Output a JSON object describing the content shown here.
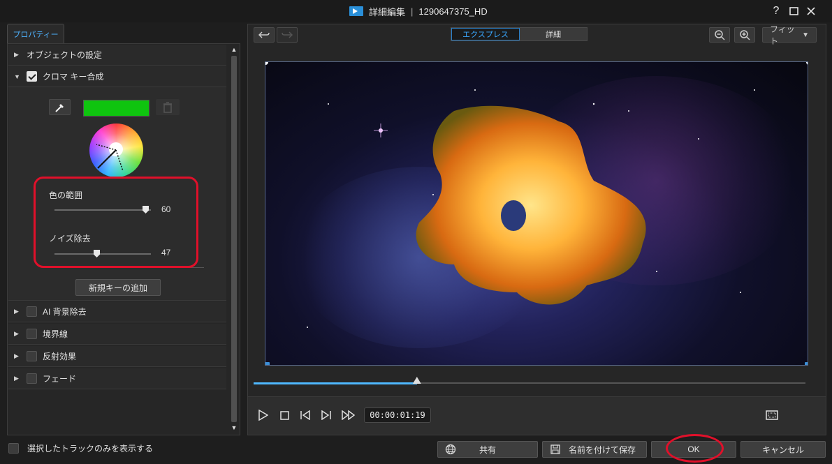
{
  "window": {
    "title": "詳細編集",
    "separator": "|",
    "file_name": "1290647375_HD",
    "help_icon": "help-icon",
    "maximize_icon": "maximize-icon",
    "close_icon": "close-icon"
  },
  "left_panel": {
    "tab_label": "プロパティー",
    "sections": [
      {
        "label": "オブジェクトの設定",
        "expanded": false,
        "has_checkbox": false
      },
      {
        "label": "クロマ キー合成",
        "expanded": true,
        "has_checkbox": true,
        "checked": true
      },
      {
        "label": "AI 背景除去",
        "expanded": false,
        "has_checkbox": true,
        "checked": false
      },
      {
        "label": "境界線",
        "expanded": false,
        "has_checkbox": true,
        "checked": false
      },
      {
        "label": "反射効果",
        "expanded": false,
        "has_checkbox": true,
        "checked": false
      },
      {
        "label": "フェード",
        "expanded": false,
        "has_checkbox": true,
        "checked": false
      }
    ],
    "chroma": {
      "key_color": "#0fc40f",
      "color_range_label": "色の範囲",
      "color_range_value": "60",
      "color_range_fraction": 0.91,
      "noise_label": "ノイズ除去",
      "noise_value": "47",
      "noise_fraction": 0.47,
      "add_key_label": "新規キーの追加"
    }
  },
  "footer": {
    "show_selected_label": "選択したトラックのみを表示する"
  },
  "preview": {
    "mode_express": "エクスプレス",
    "mode_detail": "詳細",
    "fit_label": "フィット",
    "timecode": "00:00:01:19",
    "progress_fraction": 0.296
  },
  "buttons": {
    "share": "共有",
    "save_as": "名前を付けて保存",
    "ok": "OK",
    "cancel": "キャンセル"
  },
  "colors": {
    "accent": "#4fb3ff",
    "highlight": "#e0102a"
  }
}
